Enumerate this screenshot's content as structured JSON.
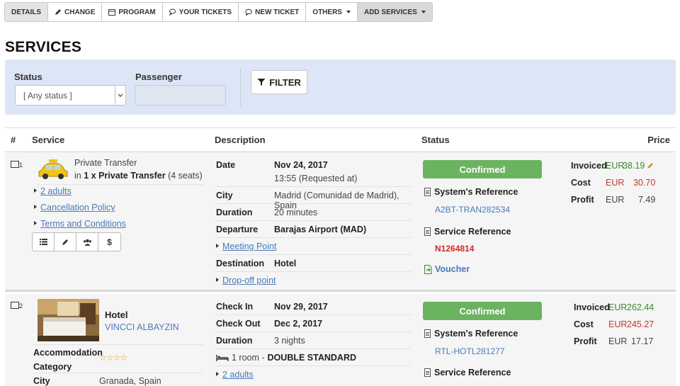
{
  "toolbar": {
    "details": "DETAILS",
    "change": "CHANGE",
    "program": "PROGRAM",
    "your_tickets": "YOUR TICKETS",
    "new_ticket": "NEW TICKET",
    "others": "OTHERS",
    "add_services": "ADD SERVICES"
  },
  "page_title": "SERVICES",
  "filter": {
    "status_label": "Status",
    "status_value": "[ Any status ]",
    "passenger_label": "Passenger",
    "passenger_value": "",
    "button": "FILTER"
  },
  "table": {
    "headers": {
      "num": "#",
      "service": "Service",
      "description": "Description",
      "status": "Status",
      "price": "Price"
    }
  },
  "rows": [
    {
      "num": "1",
      "service_type": "Private Transfer",
      "service_in": "in",
      "service_item": "1 x Private Transfer",
      "service_seats": "(4 seats)",
      "links": [
        "2 adults",
        "Cancellation Policy",
        "Terms and Conditions"
      ],
      "actions": [
        "list-icon",
        "pencil-icon",
        "group-icon",
        "$"
      ],
      "description": {
        "date_k": "Date",
        "date_v": "Nov 24, 2017",
        "date_note": "13:55 (Requested at)",
        "city_k": "City",
        "city_v": "Madrid (Comunidad de Madrid), Spain",
        "duration_k": "Duration",
        "duration_v": "20 minutes",
        "departure_k": "Departure",
        "departure_v": "Barajas Airport (MAD)",
        "meeting_point": "Meeting Point",
        "destination_k": "Destination",
        "destination_v": "Hotel",
        "dropoff": "Drop-off point"
      },
      "status": "Confirmed",
      "system_ref_label": "System's Reference",
      "system_ref": "A2BT-TRAN282534",
      "service_ref_label": "Service Reference",
      "service_ref": "N1264814",
      "voucher": "Voucher",
      "price": {
        "invoiced_k": "Invoiced",
        "invoiced_cur": "EUR",
        "invoiced_v": "38.19",
        "cost_k": "Cost",
        "cost_cur": "EUR",
        "cost_v": "30.70",
        "profit_k": "Profit",
        "profit_cur": "EUR",
        "profit_v": "7.49"
      }
    },
    {
      "num": "2",
      "service_type": "Hotel",
      "hotel_name": "VINCCI ALBAYZIN",
      "category_k": "Accommodation Category",
      "stars": "☆☆☆☆",
      "city_k": "City",
      "city_v": "Granada, Spain",
      "description": {
        "checkin_k": "Check In",
        "checkin_v": "Nov 29, 2017",
        "checkout_k": "Check Out",
        "checkout_v": "Dec 2, 2017",
        "duration_k": "Duration",
        "duration_v": "3 nights",
        "room_prefix": "1 room -",
        "room_type": "DOUBLE STANDARD",
        "adults": "2 adults"
      },
      "status": "Confirmed",
      "system_ref_label": "System's Reference",
      "system_ref": "RTL-HOTL281277",
      "service_ref_label": "Service Reference",
      "price": {
        "invoiced_k": "Invoiced",
        "invoiced_cur": "EUR",
        "invoiced_v": "262.44",
        "cost_k": "Cost",
        "cost_cur": "EUR",
        "cost_v": "245.27",
        "profit_k": "Profit",
        "profit_cur": "EUR",
        "profit_v": "17.17"
      }
    }
  ]
}
